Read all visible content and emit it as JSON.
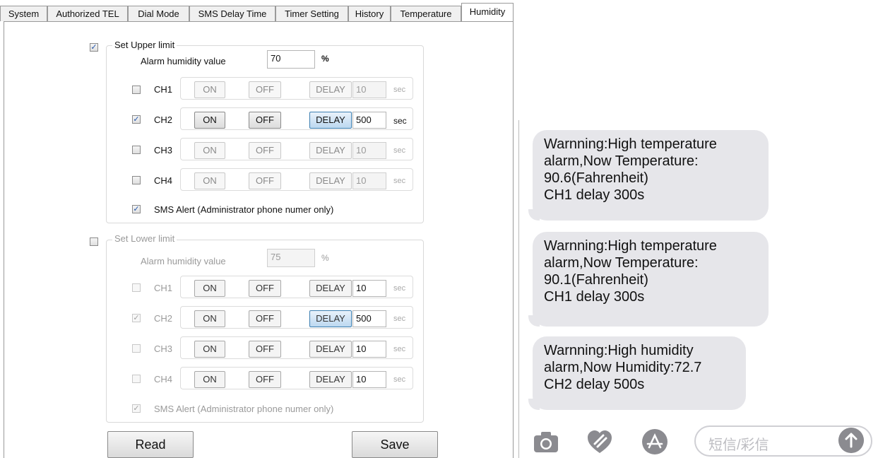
{
  "tabs": [
    {
      "label": "System"
    },
    {
      "label": "Authorized TEL"
    },
    {
      "label": "Dial Mode"
    },
    {
      "label": "SMS Delay Time"
    },
    {
      "label": "Timer Setting"
    },
    {
      "label": "History"
    },
    {
      "label": "Temperature"
    },
    {
      "label": "Humidity"
    }
  ],
  "upper": {
    "enabled": true,
    "title": "Set Upper limit",
    "alarm_label": "Alarm humidity value",
    "alarm_value": "70",
    "unit": "%",
    "channels": [
      {
        "name": "CH1",
        "checked": false,
        "on": "ON",
        "off": "OFF",
        "delay": "DELAY",
        "delay_value": "10",
        "sec": "sec"
      },
      {
        "name": "CH2",
        "checked": true,
        "on": "ON",
        "off": "OFF",
        "delay": "DELAY",
        "delay_value": "500",
        "sec": "sec"
      },
      {
        "name": "CH3",
        "checked": false,
        "on": "ON",
        "off": "OFF",
        "delay": "DELAY",
        "delay_value": "10",
        "sec": "sec"
      },
      {
        "name": "CH4",
        "checked": false,
        "on": "ON",
        "off": "OFF",
        "delay": "DELAY",
        "delay_value": "10",
        "sec": "sec"
      }
    ],
    "sms_alert": "SMS Alert (Administrator phone numer only)",
    "sms_checked": true
  },
  "lower": {
    "enabled": false,
    "title": "Set Lower limit",
    "alarm_label": "Alarm humidity value",
    "alarm_value": "75",
    "unit": "%",
    "channels": [
      {
        "name": "CH1",
        "checked": false,
        "on": "ON",
        "off": "OFF",
        "delay": "DELAY",
        "delay_value": "10",
        "sec": "sec"
      },
      {
        "name": "CH2",
        "checked": true,
        "on": "ON",
        "off": "OFF",
        "delay": "DELAY",
        "delay_value": "500",
        "sec": "sec"
      },
      {
        "name": "CH3",
        "checked": false,
        "on": "ON",
        "off": "OFF",
        "delay": "DELAY",
        "delay_value": "10",
        "sec": "sec"
      },
      {
        "name": "CH4",
        "checked": false,
        "on": "ON",
        "off": "OFF",
        "delay": "DELAY",
        "delay_value": "10",
        "sec": "sec"
      }
    ],
    "sms_alert": "SMS Alert (Administrator phone numer only)",
    "sms_checked": true
  },
  "buttons": {
    "read": "Read",
    "save": "Save"
  },
  "messages": [
    {
      "lines": [
        "Warnning:High temperature",
        "alarm,Now Temperature:",
        "90.6(Fahrenheit)",
        "CH1 delay 300s"
      ]
    },
    {
      "lines": [
        "Warnning:High temperature",
        "alarm,Now Temperature:",
        "90.1(Fahrenheit)",
        "CH1 delay 300s"
      ]
    },
    {
      "lines": [
        "Warnning:High humidity",
        "alarm,Now Humidity:72.7",
        "CH2 delay 500s"
      ]
    }
  ],
  "sms_bar": {
    "icons": [
      "camera-icon",
      "heart-hand-icon",
      "app-store-icon"
    ],
    "placeholder": "短信/彩信",
    "send_icon": "arrow-up-icon"
  },
  "colors": {
    "accent_blue": "#3c7fb1",
    "bubble": "#e6e6ea"
  }
}
